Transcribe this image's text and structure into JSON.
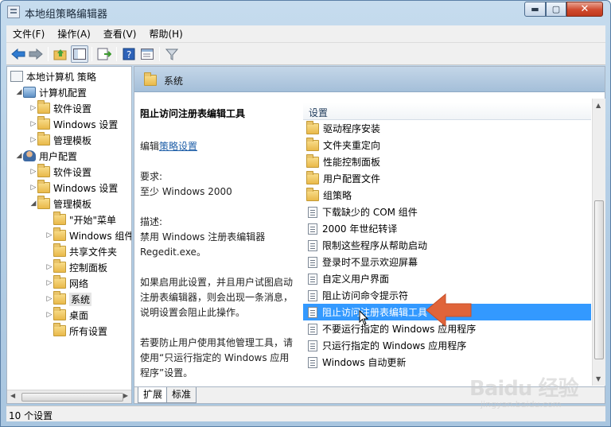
{
  "window": {
    "title": "本地组策略编辑器",
    "min": "▬",
    "max": "▢",
    "close": "✕"
  },
  "menu": [
    "文件(F)",
    "操作(A)",
    "查看(V)",
    "帮助(H)"
  ],
  "toolbar": {
    "icons": [
      "back-icon",
      "forward-icon",
      "up-folder-icon",
      "show-tree-icon",
      "export-icon",
      "help-icon",
      "properties-icon",
      "filter-icon"
    ]
  },
  "tree": {
    "root": "本地计算机 策略",
    "items": [
      {
        "label": "计算机配置",
        "level": 1,
        "icon": "computer"
      },
      {
        "label": "软件设置",
        "level": 2,
        "icon": "folder"
      },
      {
        "label": "Windows 设置",
        "level": 2,
        "icon": "folder"
      },
      {
        "label": "管理模板",
        "level": 2,
        "icon": "folder"
      },
      {
        "label": "用户配置",
        "level": 1,
        "icon": "user"
      },
      {
        "label": "软件设置",
        "level": 2,
        "icon": "folder"
      },
      {
        "label": "Windows 设置",
        "level": 2,
        "icon": "folder"
      },
      {
        "label": "管理模板",
        "level": 2,
        "icon": "folder"
      },
      {
        "label": "\"开始\"菜单",
        "level": 3,
        "icon": "folder"
      },
      {
        "label": "Windows 组件",
        "level": 3,
        "icon": "folder"
      },
      {
        "label": "共享文件夹",
        "level": 3,
        "icon": "folder"
      },
      {
        "label": "控制面板",
        "level": 3,
        "icon": "folder"
      },
      {
        "label": "网络",
        "level": 3,
        "icon": "folder"
      },
      {
        "label": "系统",
        "level": 3,
        "icon": "folder"
      },
      {
        "label": "桌面",
        "level": 3,
        "icon": "folder"
      },
      {
        "label": "所有设置",
        "level": 3,
        "icon": "folder"
      }
    ]
  },
  "right": {
    "header_title": "系统",
    "desc": {
      "title": "阻止访问注册表编辑工具",
      "edit_prefix": "编辑",
      "edit_link": "策略设置",
      "req_label": "要求:",
      "req_value": "至少 Windows 2000",
      "desc_label": "描述:",
      "desc_l1": "禁用 Windows 注册表编辑器",
      "desc_l2": "Regedit.exe。",
      "p2_l1": "如果启用此设置，并且用户试图启动",
      "p2_l2": "注册表编辑器，则会出现一条消息，",
      "p2_l3": "说明设置会阻止此操作。",
      "p3_l1": "若要防止用户使用其他管理工具，请",
      "p3_l2": "使用“只运行指定的 Windows 应用",
      "p3_l3": "程序”设置。"
    },
    "column": "设置",
    "items": [
      {
        "label": "驱动程序安装",
        "type": "folder"
      },
      {
        "label": "文件夹重定向",
        "type": "folder"
      },
      {
        "label": "性能控制面板",
        "type": "folder"
      },
      {
        "label": "用户配置文件",
        "type": "folder"
      },
      {
        "label": "组策略",
        "type": "folder"
      },
      {
        "label": "下载缺少的 COM 组件",
        "type": "setting"
      },
      {
        "label": "2000 年世纪转译",
        "type": "setting"
      },
      {
        "label": "限制这些程序从帮助启动",
        "type": "setting"
      },
      {
        "label": "登录时不显示欢迎屏幕",
        "type": "setting"
      },
      {
        "label": "自定义用户界面",
        "type": "setting"
      },
      {
        "label": "阻止访问命令提示符",
        "type": "setting"
      },
      {
        "label": "阻止访问注册表编辑工具",
        "type": "setting"
      },
      {
        "label": "不要运行指定的 Windows 应用程序",
        "type": "setting"
      },
      {
        "label": "只运行指定的 Windows 应用程序",
        "type": "setting"
      },
      {
        "label": "Windows 自动更新",
        "type": "setting"
      }
    ],
    "selected_index": 11,
    "tabs": [
      "扩展",
      "标准"
    ]
  },
  "status": "10 个设置",
  "watermark": {
    "big": "Baidu 经验",
    "small": "jingyan.baidu.com"
  },
  "colors": {
    "selection": "#3399ff",
    "link": "#1f5fa8",
    "annotation_arrow": "#e0643a"
  }
}
